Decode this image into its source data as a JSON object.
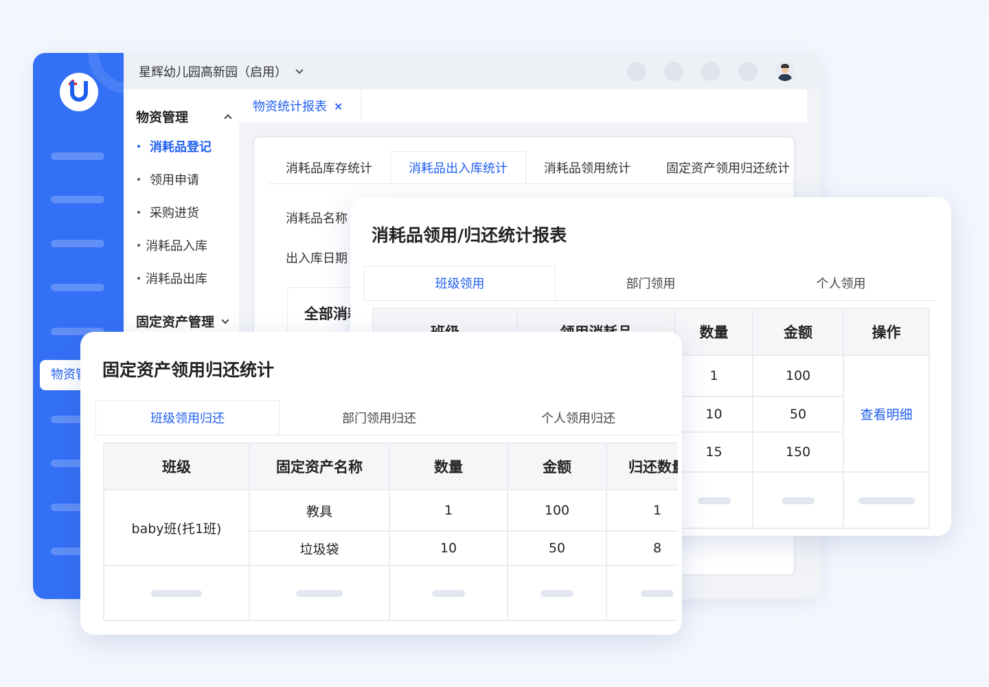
{
  "app": {
    "org_name": "星辉幼儿园高新园（启用）",
    "page_tab": "物资统计报表",
    "page_tab_close": "×",
    "rail_active": "物资管理"
  },
  "submenu": {
    "group1": "物资管理",
    "items": [
      "消耗品登记",
      "领用申请",
      "采购进货",
      "消耗品入库",
      "消耗品出库"
    ],
    "active_index": 0,
    "group2": "固定资产管理"
  },
  "panel": {
    "tabs": [
      "消耗品库存统计",
      "消耗品出入库统计",
      "消耗品领用统计",
      "固定资产领用归还统计"
    ],
    "active_tab": 1,
    "filter_name_label": "消耗品名称",
    "filter_date_label": "出入库日期",
    "all_box": "全部消耗品"
  },
  "consumable_report": {
    "title": "消耗品领用/归还统计报表",
    "tabs": [
      "班级领用",
      "部门领用",
      "个人领用"
    ],
    "active_tab": 0,
    "columns": [
      "班级",
      "领用消耗品",
      "数量",
      "金额",
      "操作"
    ],
    "rows": [
      {
        "qty": "1",
        "amount": "100"
      },
      {
        "qty": "10",
        "amount": "50"
      },
      {
        "qty": "15",
        "amount": "150"
      }
    ],
    "action": "查看明细"
  },
  "asset_report": {
    "title": "固定资产领用归还统计",
    "tabs": [
      "班级领用归还",
      "部门领用归还",
      "个人领用归还"
    ],
    "active_tab": 0,
    "columns": [
      "班级",
      "固定资产名称",
      "数量",
      "金额",
      "归还数量"
    ],
    "class_name": "baby班(托1班)",
    "rows": [
      {
        "name": "教具",
        "qty": "1",
        "amount": "100",
        "returned": "1"
      },
      {
        "name": "垃圾袋",
        "qty": "10",
        "amount": "50",
        "returned": "8"
      }
    ]
  },
  "colors": {
    "accent": "#1f5ff0",
    "rail": "#3470f5"
  }
}
